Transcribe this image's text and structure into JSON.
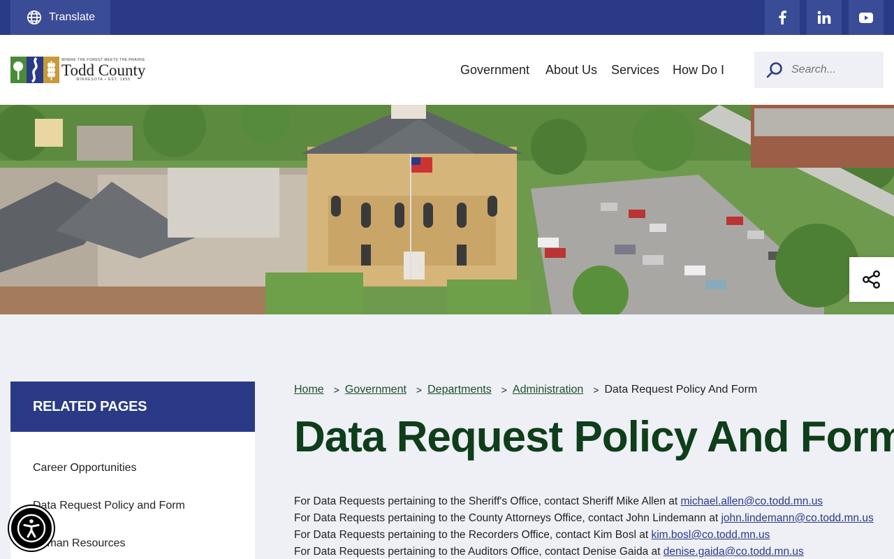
{
  "topbar": {
    "translate_label": "Translate",
    "social": [
      {
        "name": "facebook",
        "glyph": "f"
      },
      {
        "name": "linkedin",
        "glyph": "in"
      },
      {
        "name": "youtube",
        "glyph": "▶"
      }
    ]
  },
  "logo": {
    "tagline": "WHERE THE FOREST MEETS THE PRAIRIE",
    "name": "Todd County",
    "subline": "MINNESOTA • EST. 1855"
  },
  "nav": {
    "items": [
      "Government",
      "About Us",
      "Services",
      "How Do I"
    ]
  },
  "search": {
    "placeholder": "Search..."
  },
  "colors": {
    "primary": "#2a3a87",
    "primary_light": "#3b4c97",
    "title_green": "#0f3e1a",
    "link_green": "#1e4f27",
    "page_bg": "#eef0f6"
  },
  "sidebar": {
    "heading": "RELATED PAGES",
    "items": [
      "Career Opportunities",
      "Data Request Policy and Form",
      "Human Resources"
    ]
  },
  "breadcrumb": {
    "links": [
      "Home",
      "Government",
      "Departments",
      "Administration"
    ],
    "current": "Data Request Policy And Form",
    "separator": ">"
  },
  "page": {
    "title": "Data Request Policy And Form",
    "lines": [
      {
        "text": "For Data Requests pertaining to the Sheriff's Office, contact Sheriff Mike Allen at ",
        "email": "michael.allen@co.todd.mn.us"
      },
      {
        "text": "For Data Requests pertaining to the County Attorneys Office, contact John Lindemann at ",
        "email": "john.lindemann@co.todd.mn.us"
      },
      {
        "text": "For Data Requests pertaining to the Recorders Office, contact Kim Bosl at ",
        "email": "kim.bosl@co.todd.mn.us"
      },
      {
        "text": "For Data Requests pertaining to the Auditors Office, contact Denise Gaida at ",
        "email": "denise.gaida@co.todd.mn.us"
      }
    ]
  }
}
